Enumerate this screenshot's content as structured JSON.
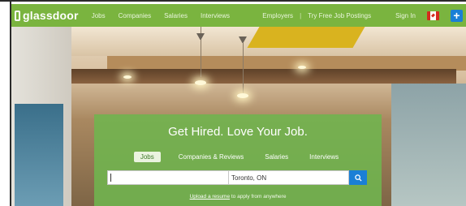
{
  "nav": {
    "logo": "glassdoor",
    "links": [
      "Jobs",
      "Companies",
      "Salaries",
      "Interviews"
    ],
    "employers": "Employers",
    "separator": "|",
    "free_postings": "Try Free Job Postings",
    "sign_in": "Sign In",
    "plus": "+"
  },
  "hero": {
    "headline": "Get Hired. Love Your Job.",
    "tabs": [
      "Jobs",
      "Companies & Reviews",
      "Salaries",
      "Interviews"
    ],
    "active_tab": "Jobs",
    "keyword_value": "",
    "location_value": "Toronto, ON",
    "upload_link": "Upload a resume",
    "upload_rest": " to apply from anywhere"
  },
  "colors": {
    "brand_green": "#7ab43f",
    "accent_blue": "#1a7fd6"
  }
}
